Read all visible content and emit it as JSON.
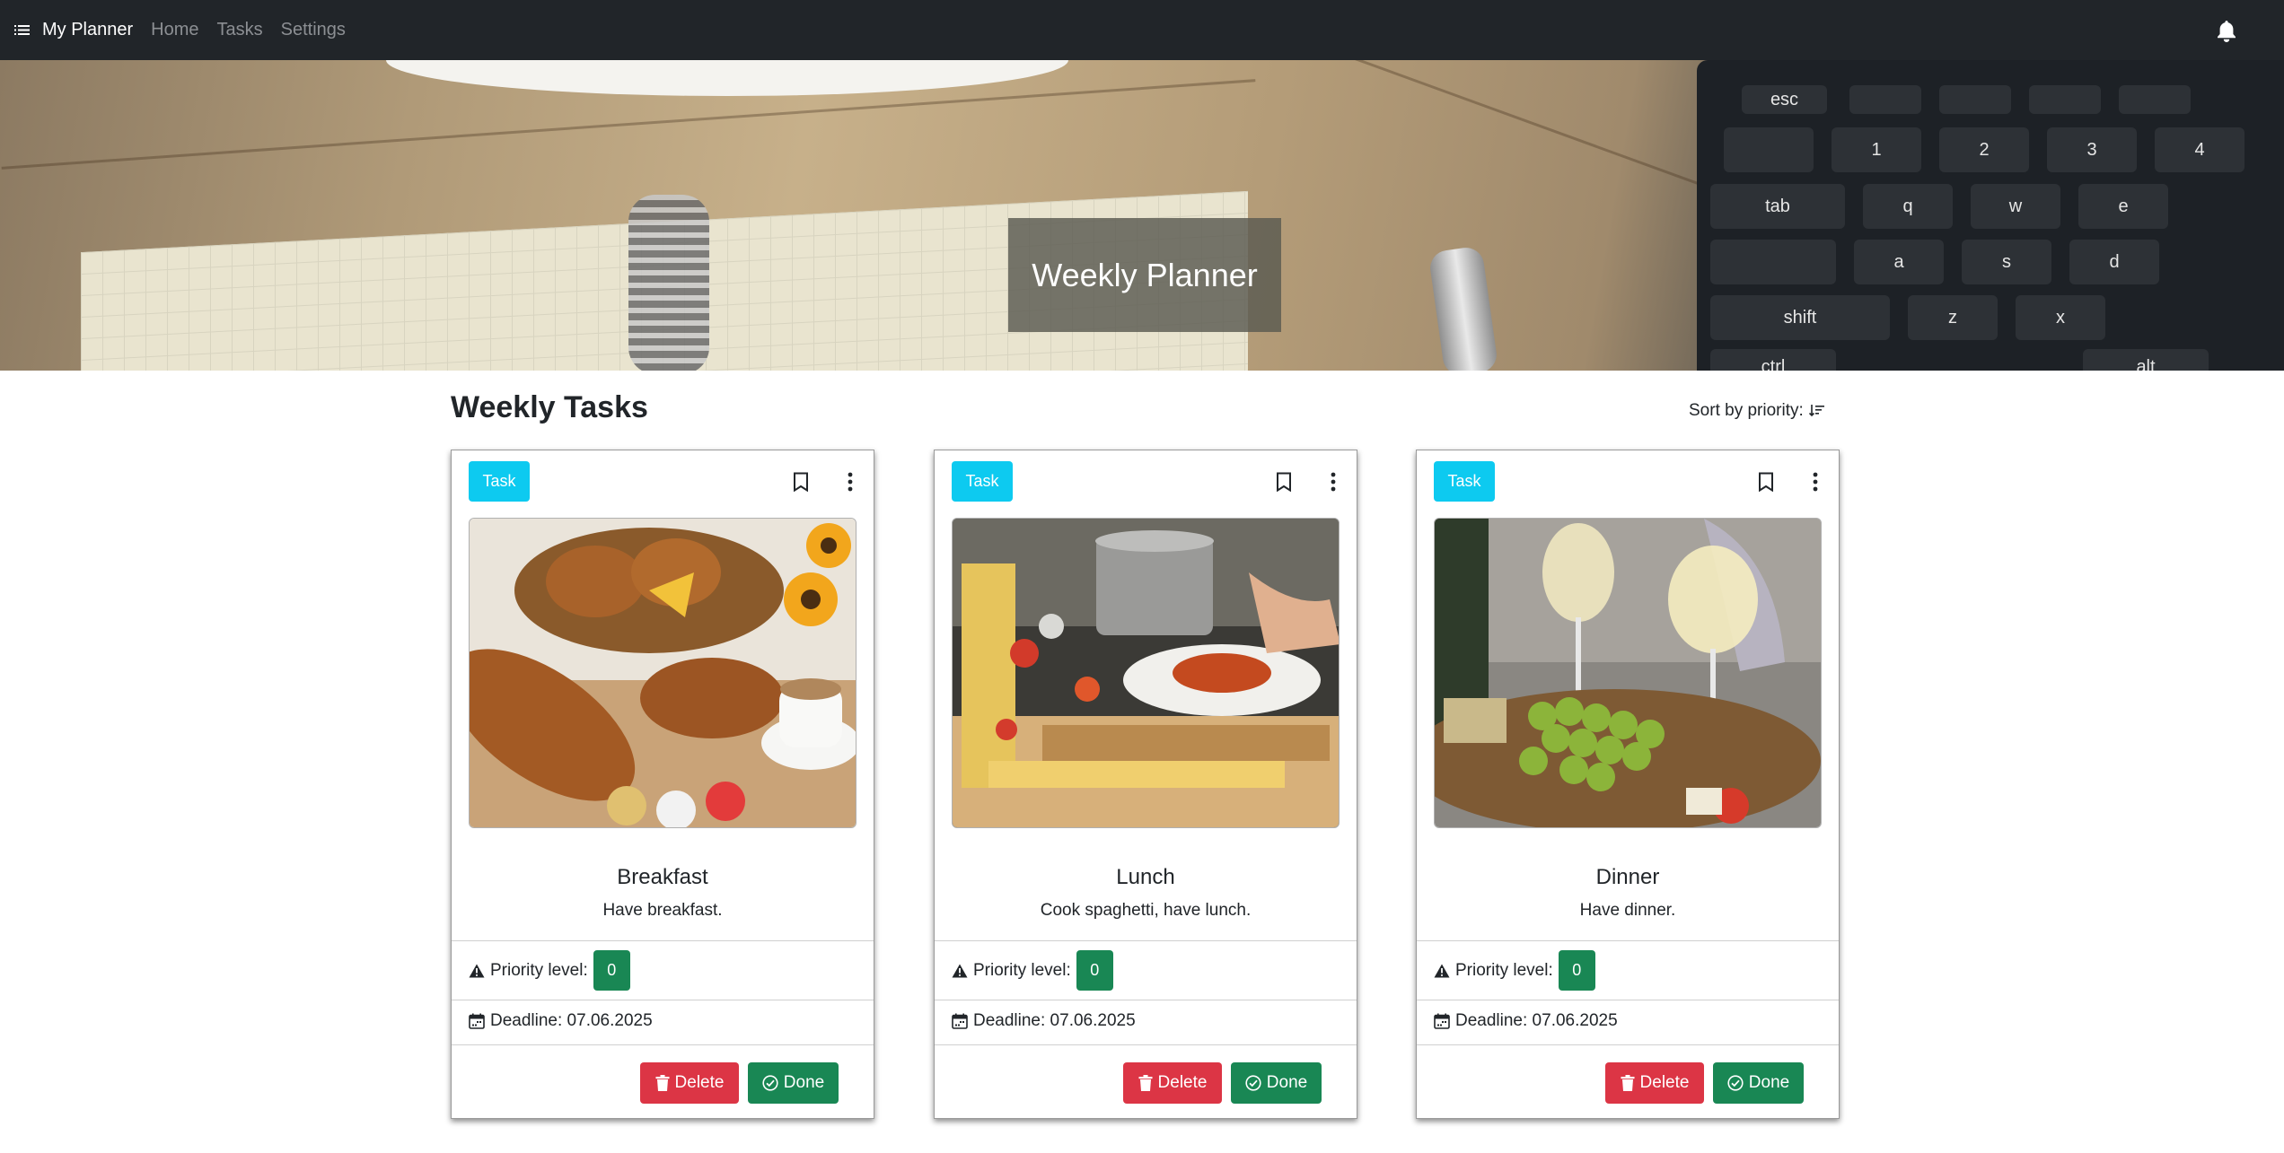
{
  "navbar": {
    "brand": "My Planner",
    "links": [
      "Home",
      "Tasks",
      "Settings"
    ]
  },
  "hero": {
    "title": "Weekly Planner"
  },
  "section": {
    "title": "Weekly Tasks",
    "sort_label": "Sort by priority:"
  },
  "cards": [
    {
      "tag": "Task",
      "title": "Breakfast",
      "text": "Have breakfast.",
      "priority_label": "Priority level:",
      "priority_value": "0",
      "deadline": "Deadline: 07.06.2025",
      "delete_label": "Delete",
      "done_label": "Done"
    },
    {
      "tag": "Task",
      "title": "Lunch",
      "text": "Cook spaghetti, have lunch.",
      "priority_label": "Priority level:",
      "priority_value": "0",
      "deadline": "Deadline: 07.06.2025",
      "delete_label": "Delete",
      "done_label": "Done"
    },
    {
      "tag": "Task",
      "title": "Dinner",
      "text": "Have dinner.",
      "priority_label": "Priority level:",
      "priority_value": "0",
      "deadline": "Deadline: 07.06.2025",
      "delete_label": "Delete",
      "done_label": "Done"
    }
  ],
  "keyboard_keys": [
    "esc",
    "tab",
    "q",
    "w",
    "e",
    "a",
    "s",
    "d",
    "shift",
    "z",
    "x",
    "ctrl",
    "alt",
    "1",
    "2",
    "3",
    "4"
  ],
  "icons": {
    "menu": "list-icon",
    "bell": "bell-icon",
    "sort": "sort-priority-icon",
    "bookmark": "bookmark-icon",
    "more": "three-dots-vertical-icon",
    "priority": "warning-triangle-icon",
    "deadline": "calendar-icon",
    "delete": "trash-icon",
    "done": "check-circle-icon"
  },
  "colors": {
    "navbar": "#212529",
    "tag": "#0dcaf0",
    "success": "#198754",
    "danger": "#dc3545"
  }
}
